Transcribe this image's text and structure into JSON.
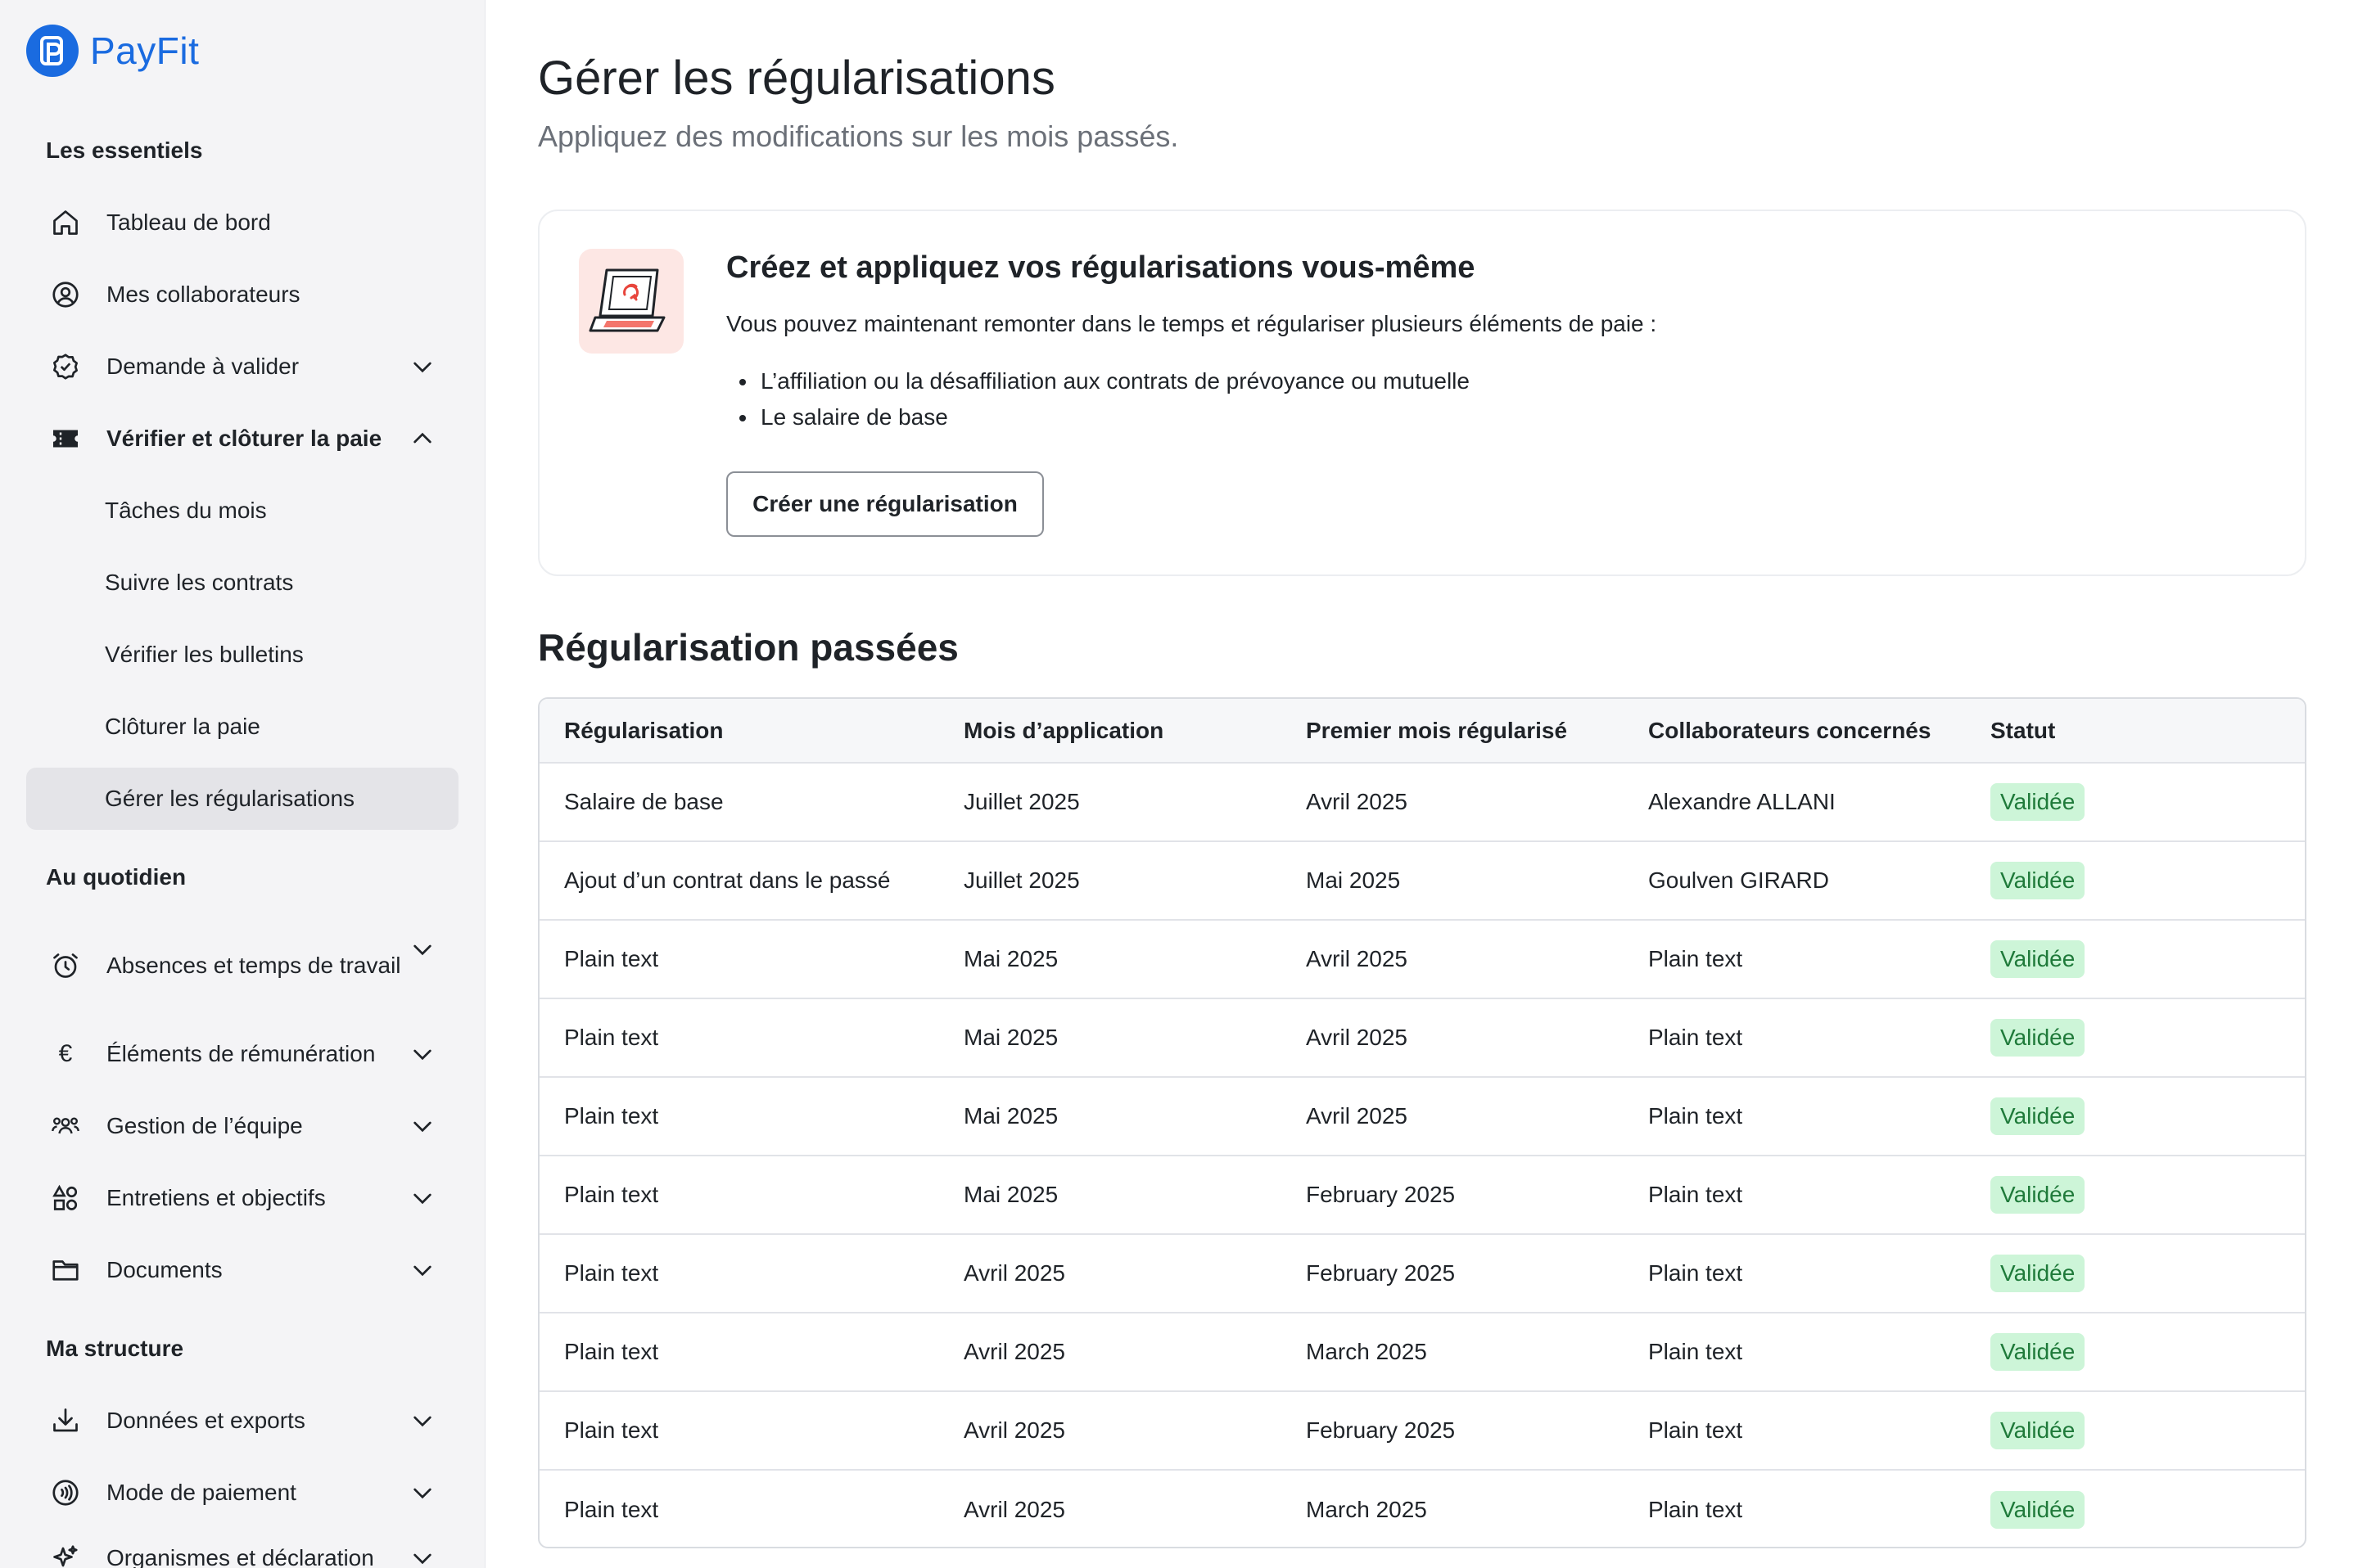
{
  "app": {
    "brand": "PayFit",
    "brand_color": "#1a6be0"
  },
  "sidebar": {
    "sections": [
      {
        "title": "Les essentiels"
      },
      {
        "title": "Au quotidien"
      },
      {
        "title": "Ma structure"
      }
    ],
    "items": [
      {
        "label": "Tableau de bord",
        "icon": "home-icon"
      },
      {
        "label": "Mes collaborateurs",
        "icon": "user-circle-icon"
      },
      {
        "label": "Demande à valider",
        "icon": "badge-check-icon"
      },
      {
        "label": "Vérifier et clôturer la paie",
        "icon": "ticket-icon"
      },
      {
        "label": "Absences et temps de travail",
        "icon": "alarm-clock-icon"
      },
      {
        "label": "Éléments de rémunération",
        "icon": "euro-icon"
      },
      {
        "label": "Gestion de l’équipe",
        "icon": "team-icon"
      },
      {
        "label": "Entretiens et objectifs",
        "icon": "shapes-icon"
      },
      {
        "label": "Documents",
        "icon": "folder-icon"
      },
      {
        "label": "Données et exports",
        "icon": "download-icon"
      },
      {
        "label": "Mode de paiement",
        "icon": "contactless-icon"
      },
      {
        "label": "Organismes et déclaration",
        "icon": "sparkle-icon"
      }
    ],
    "sub_items": [
      {
        "label": "Tâches du mois"
      },
      {
        "label": "Suivre les contrats"
      },
      {
        "label": "Vérifier les bulletins"
      },
      {
        "label": "Clôturer la paie"
      },
      {
        "label": "Gérer les régularisations",
        "active": true
      }
    ]
  },
  "main": {
    "title": "Gérer les régularisations",
    "subtitle": "Appliquez des modifications sur les mois passés.",
    "promo": {
      "title": "Créez et appliquez vos régularisations vous-même",
      "text": "Vous pouvez maintenant remonter dans le temps et régulariser plusieurs éléments de paie :",
      "bullets": [
        "L’affiliation ou la désaffiliation aux contrats de prévoyance ou mutuelle",
        "Le salaire de base"
      ],
      "button_label": "Créer une régularisation",
      "illustration": "laptop-refresh-illustration"
    },
    "past_title": "Régularisation passées",
    "table": {
      "headers": [
        "Régularisation",
        "Mois d’application",
        "Premier mois régularisé",
        "Collaborateurs concernés",
        "Statut"
      ],
      "rows": [
        [
          "Salaire de base",
          "Juillet 2025",
          "Avril 2025",
          "Alexandre ALLANI",
          "Validée"
        ],
        [
          "Ajout d’un contrat dans le passé",
          "Juillet 2025",
          "Mai 2025",
          "Goulven GIRARD",
          "Validée"
        ],
        [
          "Plain text",
          "Mai 2025",
          "Avril 2025",
          "Plain text",
          "Validée"
        ],
        [
          "Plain text",
          "Mai 2025",
          "Avril 2025",
          "Plain text",
          "Validée"
        ],
        [
          "Plain text",
          "Mai 2025",
          "Avril 2025",
          "Plain text",
          "Validée"
        ],
        [
          "Plain text",
          "Mai 2025",
          "February 2025",
          "Plain text",
          "Validée"
        ],
        [
          "Plain text",
          "Avril 2025",
          "February 2025",
          "Plain text",
          "Validée"
        ],
        [
          "Plain text",
          "Avril 2025",
          "March 2025",
          "Plain text",
          "Validée"
        ],
        [
          "Plain text",
          "Avril 2025",
          "February 2025",
          "Plain text",
          "Validée"
        ],
        [
          "Plain text",
          "Avril 2025",
          "March 2025",
          "Plain text",
          "Validée"
        ]
      ]
    }
  }
}
